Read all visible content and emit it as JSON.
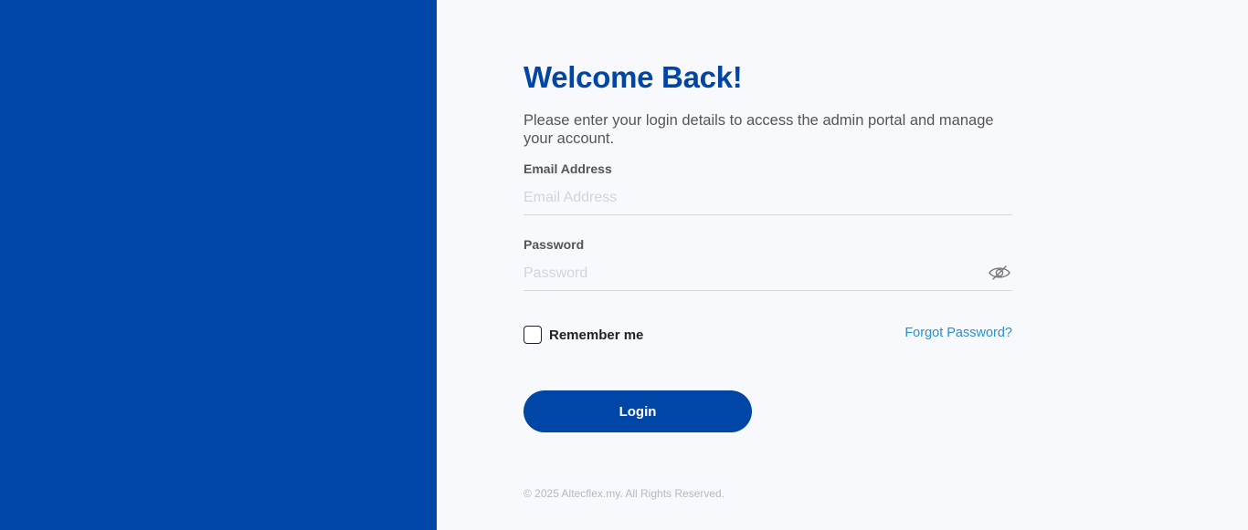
{
  "brand": {
    "primary_color": "#0046a6",
    "link_color": "#2c8fcf"
  },
  "login": {
    "title": "Welcome Back!",
    "subtitle": "Please enter your login details to access the admin portal and manage your account.",
    "email_label": "Email Address",
    "email_placeholder": "Email Address",
    "password_label": "Password",
    "password_placeholder": "Password",
    "password_toggle_icon": "eye-slash-icon",
    "remember_label": "Remember me",
    "remember_checked": false,
    "forgot_label": "Forgot Password?",
    "login_label": "Login"
  },
  "footer": {
    "copyright": "© 2025 Altecflex.my. All Rights Reserved."
  }
}
